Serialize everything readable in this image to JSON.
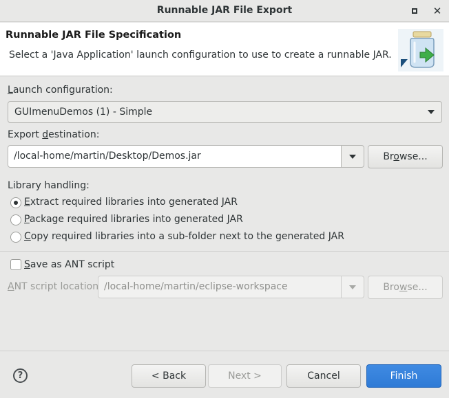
{
  "window": {
    "title": "Runnable JAR File Export",
    "maximize_glyph": "",
    "close_glyph": "✕"
  },
  "header": {
    "title": "Runnable JAR File Specification",
    "description": "Select a 'Java Application' launch configuration to use to create a runnable JAR.",
    "icon": "jar-export-icon"
  },
  "launch": {
    "label_pre": "",
    "label_mn": "L",
    "label_post": "aunch configuration:",
    "value": "GUImenuDemos (1) - Simple"
  },
  "export": {
    "label_pre": "Export ",
    "label_mn": "d",
    "label_post": "estination:",
    "value": "/local-home/martin/Desktop/Demos.jar",
    "browse_pre": "Br",
    "browse_mn": "o",
    "browse_post": "wse..."
  },
  "library": {
    "label": "Library handling:",
    "options": [
      {
        "pre": "",
        "mn": "E",
        "post": "xtract required libraries into generated JAR",
        "checked": true
      },
      {
        "pre": "",
        "mn": "P",
        "post": "ackage required libraries into generated JAR",
        "checked": false
      },
      {
        "pre": "",
        "mn": "C",
        "post": "opy required libraries into a sub-folder next to the generated JAR",
        "checked": false
      }
    ]
  },
  "ant": {
    "save_pre": "",
    "save_mn": "S",
    "save_post": "ave as ANT script",
    "save_checked": false,
    "location_pre": "",
    "location_mn": "A",
    "location_post": "NT script location:",
    "location_value": "/local-home/martin/eclipse-workspace",
    "browse_pre": "Bro",
    "browse_mn": "w",
    "browse_post": "se..."
  },
  "footer": {
    "help_glyph": "?",
    "back_label": "< Back",
    "next_label": "Next >",
    "cancel_label": "Cancel",
    "finish_label": "Finish"
  },
  "colors": {
    "accent": "#3584e4",
    "window_bg": "#e8e8e7",
    "header_bg": "#ffffff"
  }
}
